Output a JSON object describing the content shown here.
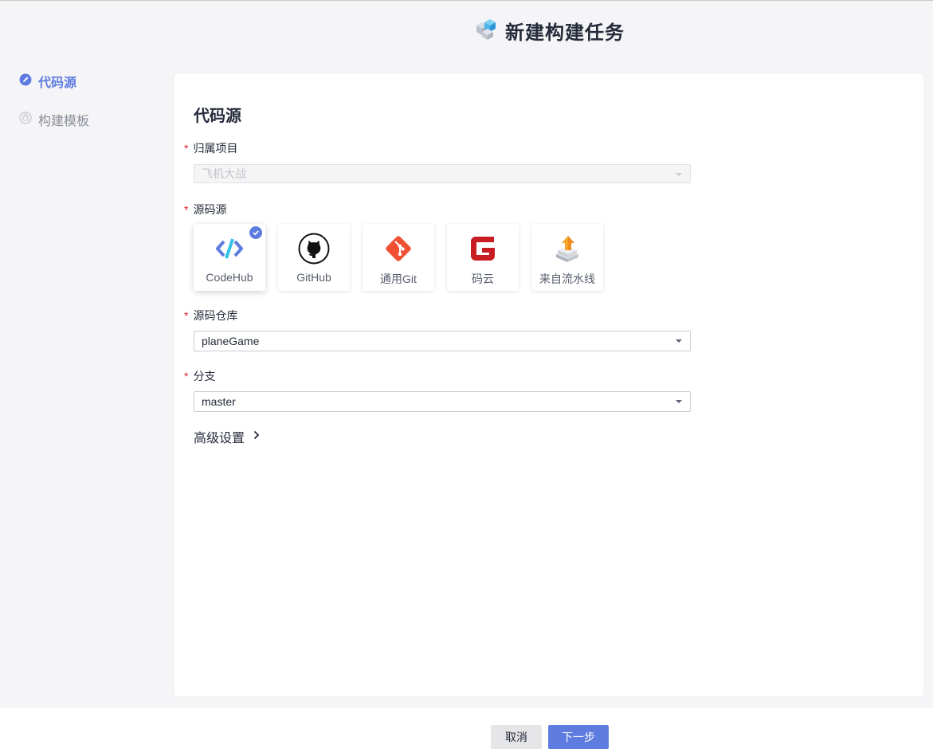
{
  "header": {
    "title": "新建构建任务"
  },
  "steps": [
    {
      "label": "代码源",
      "active": true
    },
    {
      "label": "构建模板",
      "active": false
    }
  ],
  "form": {
    "section_title": "代码源",
    "project": {
      "label": "归属项目",
      "value": "飞机大战"
    },
    "source": {
      "label": "源码源",
      "options": [
        {
          "name": "CodeHub",
          "icon": "codehub-icon",
          "selected": true
        },
        {
          "name": "GitHub",
          "icon": "github-icon",
          "selected": false
        },
        {
          "name": "通用Git",
          "icon": "git-icon",
          "selected": false
        },
        {
          "name": "码云",
          "icon": "gitee-icon",
          "selected": false
        },
        {
          "name": "来自流水线",
          "icon": "pipeline-icon",
          "selected": false
        }
      ]
    },
    "repo": {
      "label": "源码仓库",
      "value": "planeGame"
    },
    "branch": {
      "label": "分支",
      "value": "master"
    },
    "advanced_label": "高级设置"
  },
  "footer": {
    "cancel_label": "取消",
    "next_label": "下一步"
  },
  "colors": {
    "accent": "#5e7ce0",
    "required": "#e0202b",
    "background": "#f5f5f7",
    "gitee_red": "#c71d23",
    "git_orange": "#f05133"
  }
}
